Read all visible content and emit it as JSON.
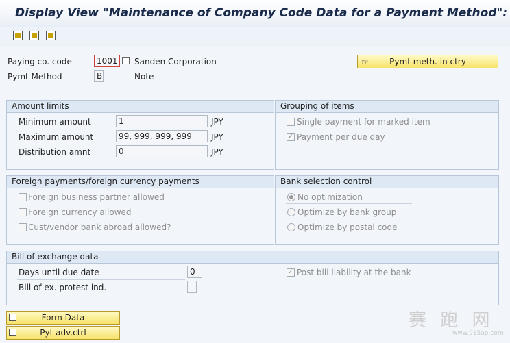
{
  "window": {
    "title": "Display View \"Maintenance of Company Code Data for a Payment Method\":"
  },
  "header": {
    "paying_co_code_label": "Paying co. code",
    "paying_co_code_value": "1001",
    "company_name": "Sanden Corporation",
    "pymt_method_label": "Pymt Method",
    "pymt_method_value": "B",
    "pymt_method_desc": "Note",
    "pymt_meth_ctry_button": "Pymt meth. in ctry"
  },
  "amount_limits": {
    "title": "Amount limits",
    "min_label": "Minimum amount",
    "min_value": "1",
    "max_label": "Maximum amount",
    "max_value": "99, 999, 999, 999",
    "dist_label": "Distribution amnt",
    "dist_value": "0",
    "currency": "JPY"
  },
  "grouping": {
    "title": "Grouping of items",
    "single_payment": "Single payment for marked item",
    "single_payment_checked": false,
    "payment_per_due_day": "Payment per due day",
    "payment_per_due_day_checked": true
  },
  "foreign": {
    "title": "Foreign payments/foreign currency payments",
    "partner_allowed": "Foreign business partner allowed",
    "currency_allowed": "Foreign currency allowed",
    "bank_abroad": "Cust/vendor bank abroad allowed?"
  },
  "bank_selection": {
    "title": "Bank selection control",
    "no_optimization": "No optimization",
    "by_bank_group": "Optimize by bank group",
    "by_postal_code": "Optimize by postal code",
    "selected": "No optimization"
  },
  "bill_of_exchange": {
    "title": "Bill of exchange data",
    "days_label": "Days until due date",
    "days_value": "0",
    "protest_label": "Bill of ex. protest ind.",
    "post_liability": "Post bill liability at the bank",
    "post_liability_checked": true
  },
  "footer_buttons": {
    "form_data": "Form Data",
    "pyt_adv_ctrl": "Pyt adv.ctrl"
  },
  "watermark": {
    "text": "赛 跑 网",
    "url": "www.915ap.com"
  },
  "colors": {
    "group_header_bg": "#dde8f4",
    "button_yellow": "#f7e36a",
    "background": "#f2f6fb"
  }
}
